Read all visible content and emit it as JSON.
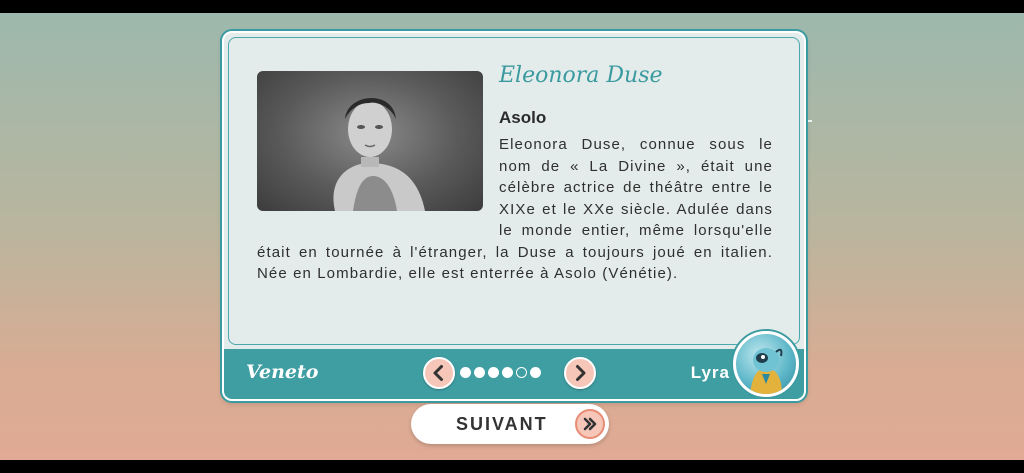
{
  "card": {
    "title": "Eleonora Duse",
    "subtitle": "Asolo",
    "description": "Eleonora Duse, connue sous le nom de « La Divine », était une célèbre actrice de théâtre entre le XIXe et le XXe siècle. Adulée dans le monde entier, même lorsqu'elle était en tournée à l'étranger, la Duse a toujours joué en italien. Née en Lombardie, elle est enterrée à Asolo (Vénétie)."
  },
  "footer": {
    "region": "Veneto",
    "guide_name": "Lyra",
    "pagination": {
      "total": 6,
      "current": 5
    }
  },
  "next_button": {
    "label": "SUIVANT"
  },
  "icons": {
    "prev": "chevron-left-icon",
    "next": "chevron-right-icon",
    "continue": "double-chevron-right-icon"
  },
  "colors": {
    "accent_teal": "#3f9ea2",
    "button_pink": "#f6c6b8",
    "card_bg": "#e3ecea"
  }
}
